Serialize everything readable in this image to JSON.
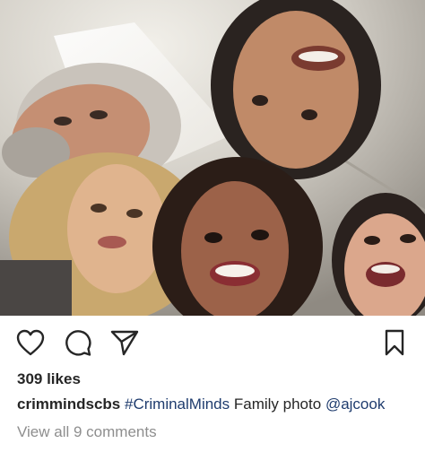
{
  "post": {
    "likes": "309 likes",
    "caption": {
      "username": "crimmindscbs",
      "hashtag": "#CriminalMinds",
      "text": "Family photo",
      "mention": "@ajcook"
    },
    "view_comments": "View all 9 comments"
  },
  "icons": {
    "like": "heart-icon",
    "comment": "comment-bubble-icon",
    "share": "paper-plane-icon",
    "save": "bookmark-icon"
  },
  "colors": {
    "text": "#262626",
    "muted": "#8e8e8e",
    "link": "#1f3c6e",
    "background": "#ffffff"
  }
}
